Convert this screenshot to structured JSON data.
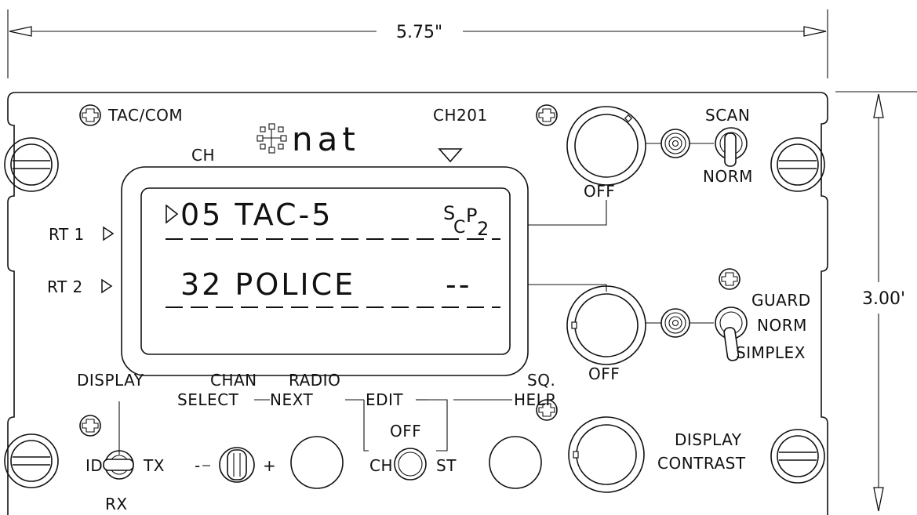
{
  "dimensions": {
    "width_label": "5.75\"",
    "height_label": "3.00'"
  },
  "brand": {
    "logo_text": "nat"
  },
  "labels": {
    "tac_com": "TAC/COM",
    "ch": "CH",
    "ch201": "CH201",
    "scan": "SCAN",
    "norm_top": "NORM",
    "off_top": "OFF",
    "rt1": "RT 1",
    "rt2": "RT 2",
    "guard": "GUARD",
    "norm_mid": "NORM",
    "simplex": "SIMPLEX",
    "off_mid": "OFF",
    "display": "DISPLAY",
    "chan": "CHAN",
    "radio": "RADIO",
    "sq": "SQ.",
    "select": "SELECT",
    "next": "NEXT",
    "edit": "EDIT",
    "help": "HELP",
    "id": "ID",
    "tx": "TX",
    "rx": "RX",
    "minus": "-",
    "plus": "+",
    "ch_small": "CH",
    "off_small": "OFF",
    "st": "ST",
    "display2": "DISPLAY",
    "contrast": "CONTRAST"
  },
  "lcd": {
    "row1_channel": "05 TAC-5",
    "row1_status_s": "S",
    "row1_status_c": "C",
    "row1_status_p": "P",
    "row1_status_2": "2",
    "row2_channel": "32 POLICE",
    "row2_status": "--"
  }
}
